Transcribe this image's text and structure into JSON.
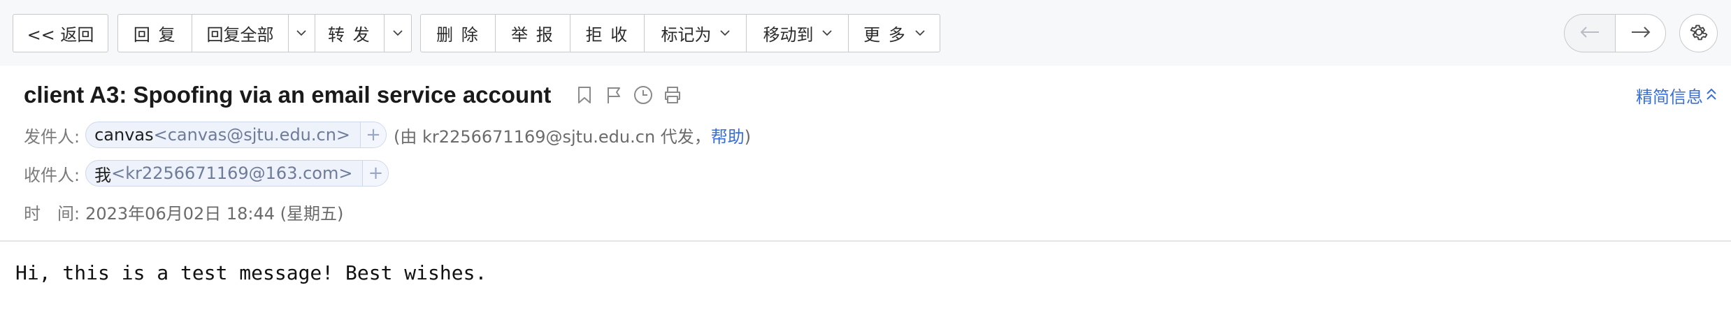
{
  "toolbar": {
    "back_label": "<< 返回",
    "reply_label": "回 复",
    "reply_all_label": "回复全部",
    "forward_label": "转 发",
    "delete_label": "删 除",
    "report_label": "举 报",
    "reject_label": "拒 收",
    "mark_as_label": "标记为",
    "move_to_label": "移动到",
    "more_label": "更 多"
  },
  "header": {
    "subject": "client A3: Spoofing via an email service account",
    "brief_info_label": "精简信息",
    "from_label": "发件人:",
    "from_name": "canvas",
    "from_address": "<canvas@sjtu.edu.cn>",
    "sender_note_prefix": "(由 kr2256671169@sjtu.edu.cn 代发，",
    "help_label": "帮助",
    "sender_note_suffix": ")",
    "to_label": "收件人:",
    "to_name": "我",
    "to_address": "<kr2256671169@163.com>",
    "time_label": "时　间:",
    "time_value": "2023年06月02日 18:44 (星期五)"
  },
  "body": {
    "text": "Hi, this is a test message! Best wishes."
  },
  "icons": [
    "chevron-down-icon",
    "arrow-left-icon",
    "arrow-right-icon",
    "gear-icon",
    "bookmark-icon",
    "flag-icon",
    "clock-icon",
    "print-icon",
    "double-chevron-up-icon",
    "plus-icon"
  ],
  "colors": {
    "link": "#3a6fd8",
    "toolbar_bg": "#f7f8fa",
    "chip_bg": "#eef2fb"
  }
}
